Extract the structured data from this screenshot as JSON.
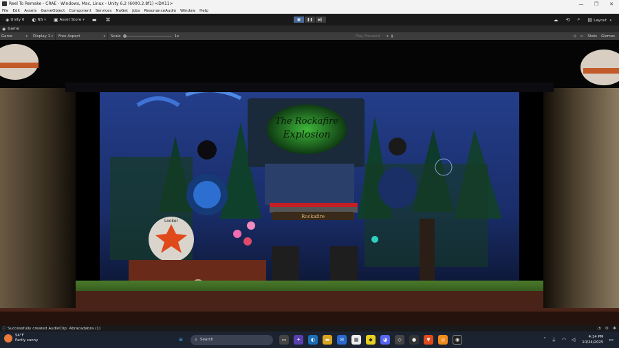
{
  "window": {
    "title": "Reel To Remake - CRAE - Windows, Mac, Linux - Unity 6.2 (6000.2.8f1) <DX11>",
    "min_glyph": "—",
    "max_glyph": "❐",
    "close_glyph": "✕"
  },
  "menu": [
    "File",
    "Edit",
    "Assets",
    "GameObject",
    "Component",
    "Services",
    "NuGet",
    "Jobs",
    "ResonanceAudio",
    "Window",
    "Help"
  ],
  "toolbar": {
    "unity_label": "Unity 6",
    "account_label": "NS",
    "asset_store_label": "Asset Store",
    "layout_label": "Layout"
  },
  "tab": {
    "label": "Game"
  },
  "gamebar": {
    "mode": "Game",
    "display": "Display 1",
    "aspect": "Free Aspect",
    "scale_label": "Scale",
    "scale_value": "1x",
    "play_focused": "Play Focused",
    "stats": "Stats",
    "gizmos": "Gizmos"
  },
  "status": {
    "message": "Successfully created AudioClip: Abracadabra (1)"
  },
  "scene": {
    "sign_line1": "The Rockafire",
    "sign_line2": "Explosion",
    "keyboard_label": "Rockafire",
    "drum_label": "Looker"
  },
  "taskbar": {
    "temp": "54°F",
    "weather": "Partly sunny",
    "search_placeholder": "Search",
    "time": "4:14 PM",
    "date": "10/24/2025"
  }
}
